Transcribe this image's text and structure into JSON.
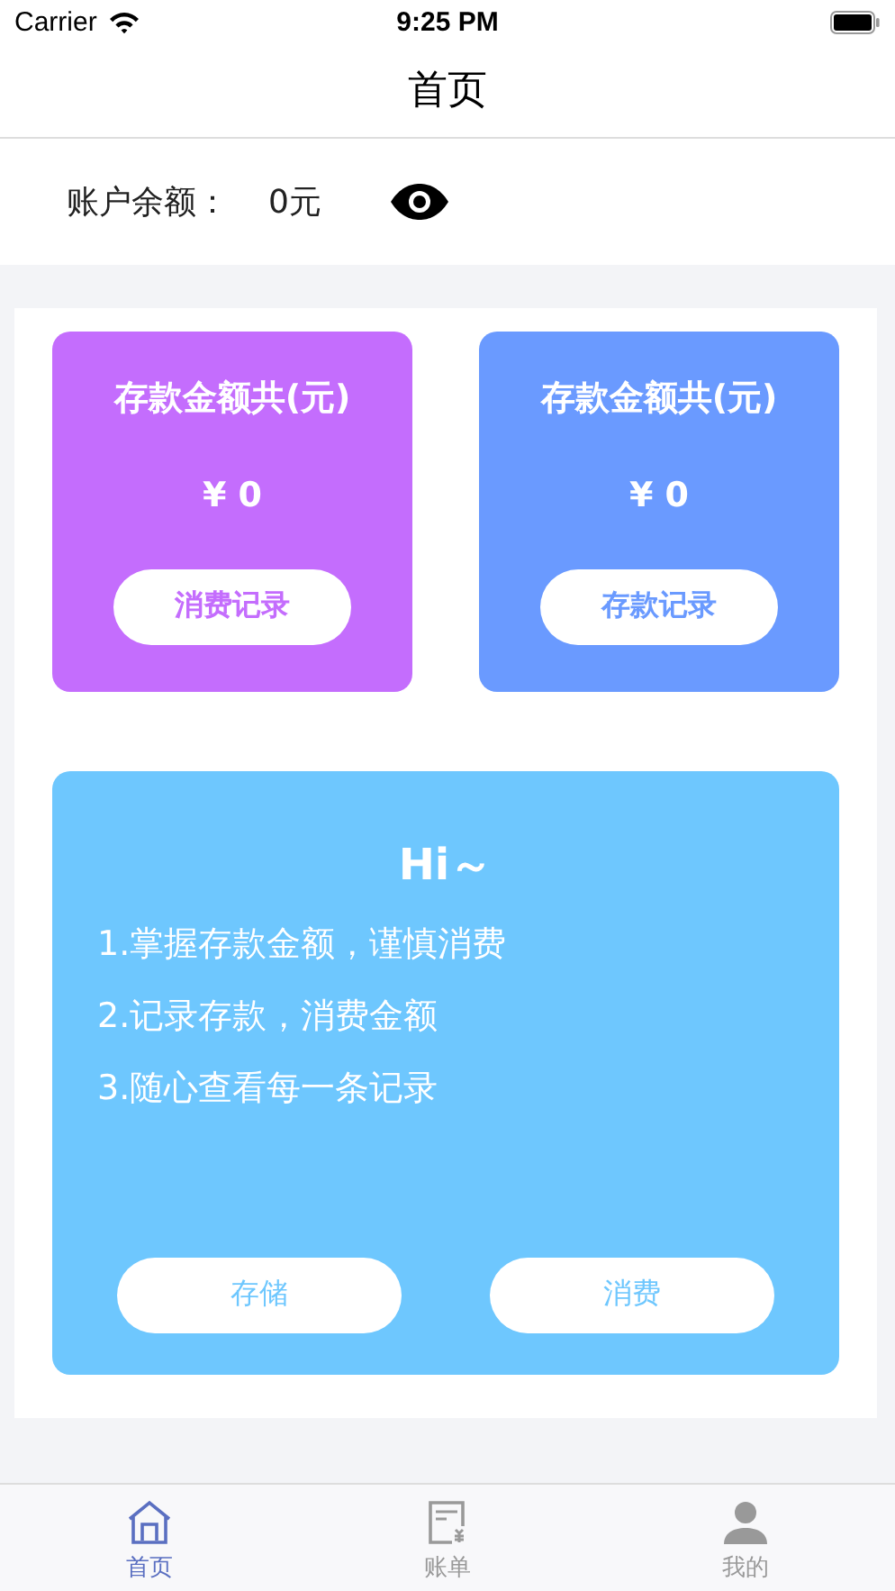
{
  "status_bar": {
    "carrier": "Carrier",
    "time": "9:25 PM"
  },
  "nav_title": "首页",
  "balance": {
    "label": "账户余额：",
    "value": "0元"
  },
  "cards": [
    {
      "title": "存款金额共(元)",
      "amount": "¥ 0",
      "button": "消费记录",
      "color": "#c46dfd"
    },
    {
      "title": "存款金额共(元)",
      "amount": "¥ 0",
      "button": "存款记录",
      "color": "#6a9aff"
    }
  ],
  "info": {
    "heading": "Hi～",
    "lines": [
      "1.掌握存款金额，谨慎消费",
      "2.记录存款，消费金额",
      "3.随心查看每一条记录"
    ],
    "buttons": [
      "存储",
      "消费"
    ]
  },
  "tabs": [
    {
      "label": "首页",
      "kind": "home",
      "selected": true
    },
    {
      "label": "账单",
      "kind": "bill",
      "selected": false
    },
    {
      "label": "我的",
      "kind": "user",
      "selected": false
    }
  ]
}
